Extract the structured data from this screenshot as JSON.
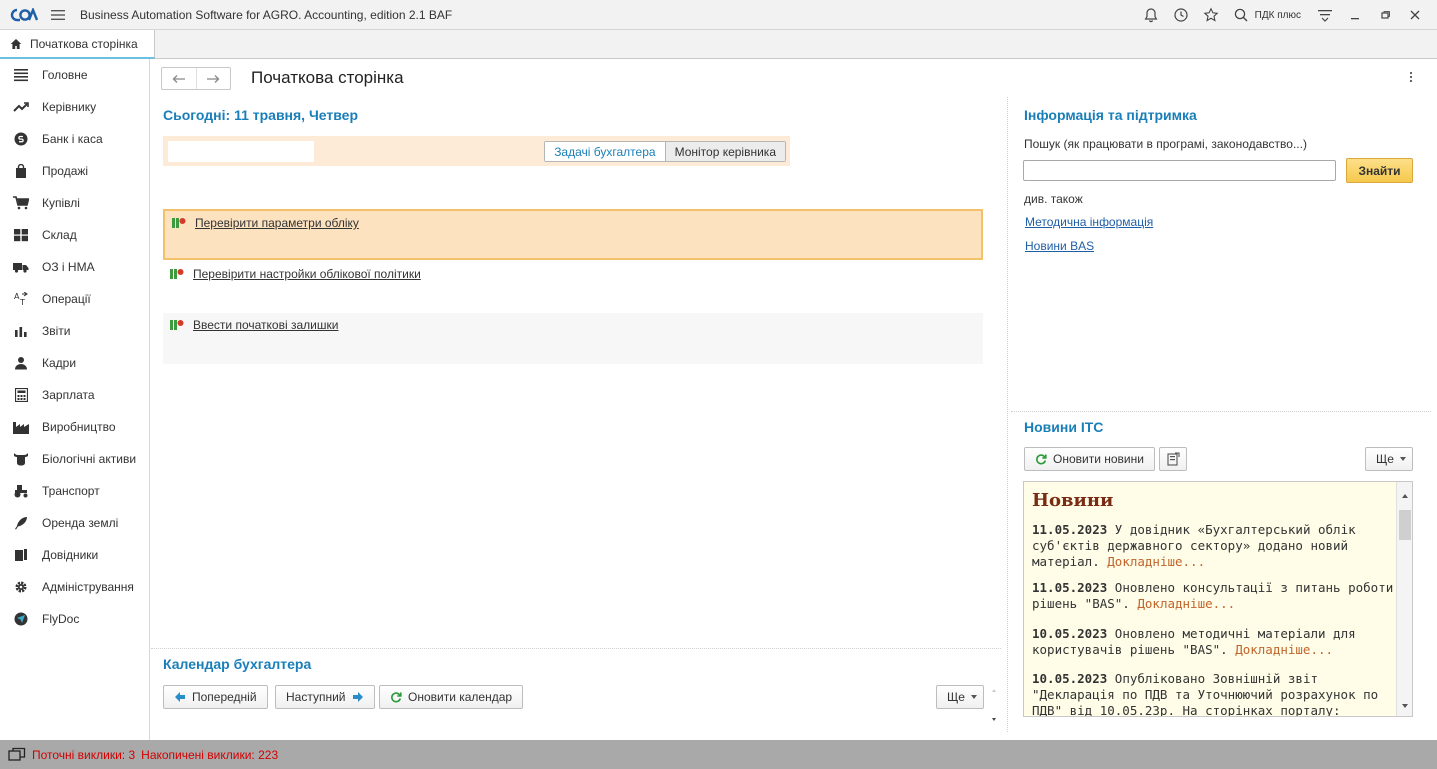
{
  "window": {
    "title": "Business Automation Software for AGRO. Accounting, edition 2.1 BAF",
    "user": "ПДК плюс"
  },
  "tabs": [
    {
      "label": "Початкова сторінка"
    }
  ],
  "sidebar": {
    "items": [
      {
        "label": "Головне",
        "icon": "menu-lines-icon"
      },
      {
        "label": "Керівнику",
        "icon": "trend-icon"
      },
      {
        "label": "Банк і каса",
        "icon": "coin-icon"
      },
      {
        "label": "Продажі",
        "icon": "bag-icon"
      },
      {
        "label": "Купівлі",
        "icon": "cart-icon"
      },
      {
        "label": "Склад",
        "icon": "warehouse-icon"
      },
      {
        "label": "ОЗ і НМА",
        "icon": "truck-icon"
      },
      {
        "label": "Операції",
        "icon": "operations-icon"
      },
      {
        "label": "Звіти",
        "icon": "bar-chart-icon"
      },
      {
        "label": "Кадри",
        "icon": "person-icon"
      },
      {
        "label": "Зарплата",
        "icon": "calculator-icon"
      },
      {
        "label": "Виробництво",
        "icon": "factory-icon"
      },
      {
        "label": "Біологічні активи",
        "icon": "cow-icon"
      },
      {
        "label": "Транспорт",
        "icon": "tractor-icon"
      },
      {
        "label": "Оренда землі",
        "icon": "feather-icon"
      },
      {
        "label": "Довідники",
        "icon": "books-icon"
      },
      {
        "label": "Адміністрування",
        "icon": "gear-icon"
      },
      {
        "label": "FlyDoc",
        "icon": "flydoc-icon"
      }
    ]
  },
  "main": {
    "title": "Початкова сторінка",
    "today": "Сьогодні: 11 травня, Четвер",
    "segments": [
      "Задачі бухгалтера",
      "Монітор керівника"
    ],
    "tasks": [
      {
        "label": "Перевірити параметри обліку"
      },
      {
        "label": "Перевірити настройки облікової політики"
      },
      {
        "label": "Ввести початкові залишки"
      }
    ],
    "calendar": {
      "title": "Календар бухгалтера",
      "prev": "Попередній",
      "next": "Наступний",
      "refresh": "Оновити календар",
      "more": "Ще"
    }
  },
  "info": {
    "title": "Інформація та підтримка",
    "search_label": "Пошук (як працювати в програмі, законодавство...)",
    "search_button": "Знайти",
    "see_also": "див. також",
    "links": [
      "Методична інформація",
      "Новини BAS"
    ]
  },
  "news_itc": {
    "title": "Новини ІТС",
    "refresh": "Оновити новини",
    "more": "Ще",
    "heading": "Новини",
    "items": [
      {
        "date": "11.05.2023",
        "text": "У довідник «Бухгалтерський облік суб'єктів державного сектору» додано новий матеріал.",
        "more": "Докладніше..."
      },
      {
        "date": "11.05.2023",
        "text": "Оновлено консультації з питань роботи рішень \"BAS\".",
        "more": "Докладніше..."
      },
      {
        "date": "10.05.2023",
        "text": "Оновлено методичні матеріали для користувачів рішень \"BAS\".",
        "more": "Докладніше..."
      },
      {
        "date": "10.05.2023",
        "text": "Опубліковано Зовнішній звіт \"Декларація по ПДВ та Уточнюючий розрахунок по ПДВ\" від 10.05.23р. На сторінках порталу:",
        "more": ""
      }
    ]
  },
  "status": {
    "current_calls": "Поточні виклики: 3",
    "accumulated_calls": "Накопичені виклики: 223"
  },
  "colors": {
    "accent": "#1a7fb8",
    "highlight_task_bg": "#fde2c0",
    "highlight_task_border": "#f2c16a",
    "filter_bg": "#fdebd8",
    "status_bg": "#a9a9a9",
    "status_text": "#d40000",
    "search_button": "#f6c84c",
    "news_title": "#7a2b14"
  }
}
